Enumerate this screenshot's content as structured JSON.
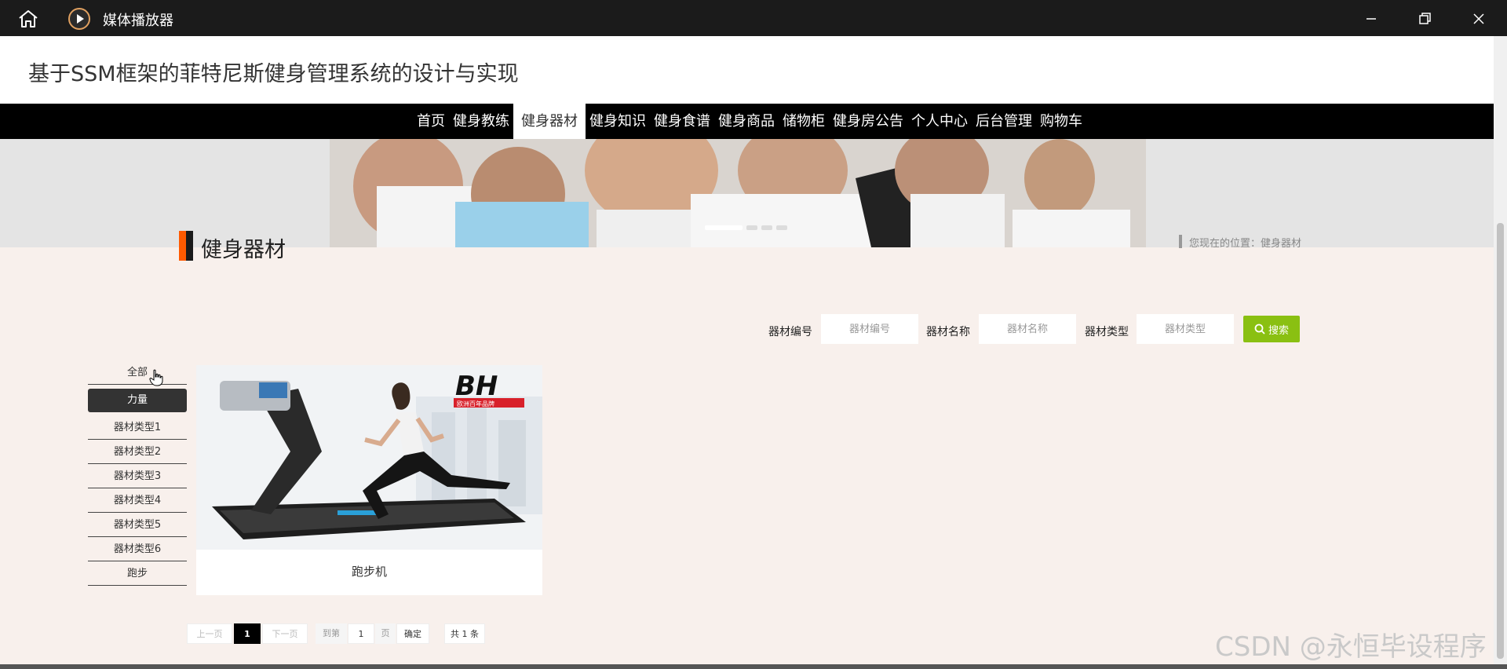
{
  "window": {
    "title": "媒体播放器",
    "icons": {
      "home": "home-icon",
      "app": "media-player-icon",
      "minimize": "minimize-icon",
      "maximize": "restore-icon",
      "close": "close-icon"
    }
  },
  "site": {
    "title": "基于SSM框架的菲特尼斯健身管理系统的设计与实现"
  },
  "nav": {
    "items": [
      "首页",
      "健身教练",
      "健身器材",
      "健身知识",
      "健身食谱",
      "健身商品",
      "储物柜",
      "健身房公告",
      "个人中心",
      "后台管理",
      "购物车"
    ],
    "active_index": 2
  },
  "section": {
    "title": "健身器材",
    "breadcrumb": "您现在的位置：健身器材"
  },
  "filters": {
    "code_label": "器材编号",
    "code_placeholder": "器材编号",
    "name_label": "器材名称",
    "name_placeholder": "器材名称",
    "type_label": "器材类型",
    "type_placeholder": "器材类型",
    "search_label": "搜索"
  },
  "categories": {
    "items": [
      "全部",
      "力量",
      "器材类型1",
      "器材类型2",
      "器材类型3",
      "器材类型4",
      "器材类型5",
      "器材类型6",
      "跑步"
    ],
    "active_index": 1
  },
  "products": [
    {
      "name": "跑步机",
      "image_brand_text": "BH",
      "image_tagline": "欧洲百年品牌"
    }
  ],
  "pagination": {
    "prev": "上一页",
    "current": "1",
    "next": "下一页",
    "goto_prefix": "到第",
    "goto_value": "1",
    "goto_suffix": "页",
    "confirm": "确定",
    "total": "共 1 条"
  },
  "watermark": "CSDN @永恒毕设程序",
  "colors": {
    "accent_orange": "#ff5a00",
    "search_green": "#8ac012",
    "nav_bg": "#000000",
    "page_bg": "#f8f0ec"
  }
}
